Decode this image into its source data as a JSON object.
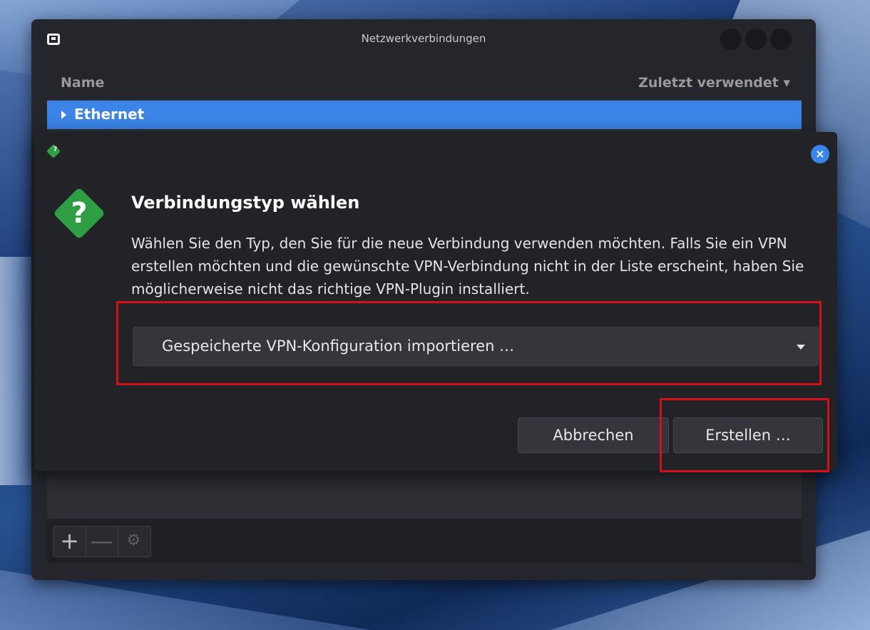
{
  "window": {
    "title": "Netzwerkverbindungen"
  },
  "connection_list": {
    "columns": [
      "Name",
      "Zuletzt verwendet"
    ],
    "rows": [
      {
        "label": "Ethernet",
        "expanded": false,
        "selected": true
      }
    ]
  },
  "toolbar": {
    "add_label": "+",
    "remove_label": "—",
    "settings_icon": "gear-icon"
  },
  "dialog": {
    "heading": "Verbindungstyp wählen",
    "message": "Wählen Sie den Typ, den Sie für die neue Verbindung verwenden möchten. Falls Sie ein VPN erstellen möchten und die gewünschte VPN-Verbindung nicht in der Liste erscheint, haben Sie möglicherweise nicht das richtige VPN-Plugin installiert.",
    "connection_type_selected": "Gespeicherte VPN-Konfiguration importieren …",
    "cancel_label": "Abbrechen",
    "create_label": "Erstellen …",
    "icon": "question-icon"
  },
  "colors": {
    "selection": "#3b84e8",
    "question_icon": "#2ea043",
    "highlight": "#d6101a"
  }
}
